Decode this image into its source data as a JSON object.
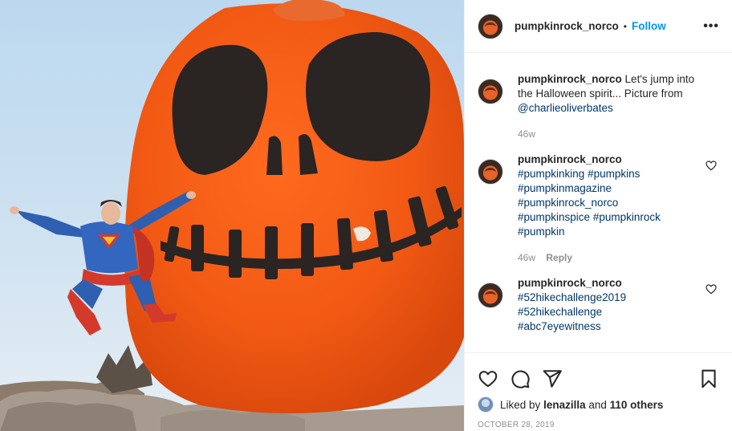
{
  "post": {
    "username": "pumpkinrock_norco",
    "separator": "•",
    "follow_label": "Follow",
    "more_label": "•••"
  },
  "comments": [
    {
      "user": "pumpkinrock_norco",
      "text_prefix": "Let's jump into the Halloween spirit... Picture from ",
      "mention": "@charlieoliverbates",
      "time": "46w"
    },
    {
      "user": "pumpkinrock_norco",
      "hashtags": [
        "#pumpkinking",
        "#pumpkins",
        "#pumpkinmagazine",
        "#pumpkinrock_norco",
        "#pumpkinspice",
        "#pumpkinrock",
        "#pumpkin"
      ],
      "time": "46w",
      "reply_label": "Reply"
    },
    {
      "user": "pumpkinrock_norco",
      "hashtags": [
        "#52hikechallenge2019",
        "#52hikechallenge",
        "#abc7eyewitness"
      ]
    }
  ],
  "likes": {
    "prefix": "Liked by",
    "user": "lenazilla",
    "connector": "and",
    "others": "110 others"
  },
  "date": "OCTOBER 28, 2019",
  "icons": {
    "like": "heart-icon",
    "comment": "comment-bubble-icon",
    "share": "paper-plane-icon",
    "save": "bookmark-icon",
    "more": "more-options-icon"
  },
  "colors": {
    "link": "#00376b",
    "follow": "#0095f6",
    "pumpkin": "#f25a14",
    "meta": "#8e8e8e"
  }
}
